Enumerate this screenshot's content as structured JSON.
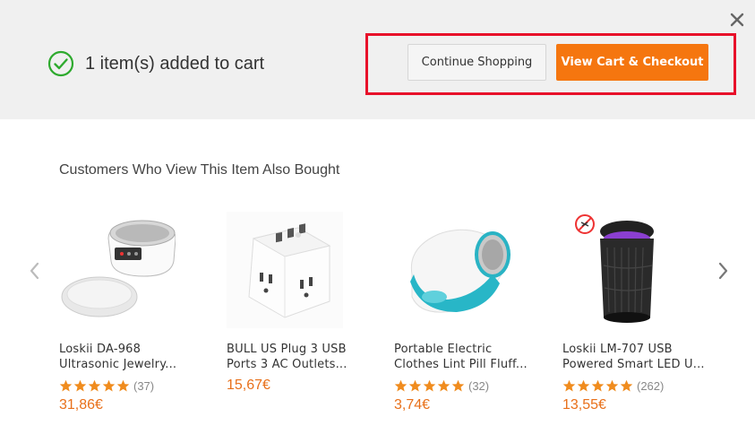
{
  "banner": {
    "message": "1 item(s) added to cart",
    "continue_label": "Continue Shopping",
    "checkout_label": "View Cart & Checkout"
  },
  "recommendations": {
    "title": "Customers Who View This Item Also Bought",
    "products": [
      {
        "name_line1": "Loskii DA-968",
        "name_line2": "Ultrasonic Jewelry...",
        "rating_count": "(37)",
        "price": "31,86€",
        "stars": 5
      },
      {
        "name_line1": "BULL US Plug 3 USB",
        "name_line2": "Ports 3 AC Outlets...",
        "rating_count": "",
        "price": "15,67€",
        "stars": 0
      },
      {
        "name_line1": "Portable Electric",
        "name_line2": "Clothes Lint Pill Fluff...",
        "rating_count": "(32)",
        "price": "3,74€",
        "stars": 5
      },
      {
        "name_line1": "Loskii LM-707 USB",
        "name_line2": "Powered Smart LED U...",
        "rating_count": "(262)",
        "price": "13,55€",
        "stars": 5
      }
    ]
  },
  "colors": {
    "accent": "#f5760f",
    "highlight": "#e8102a",
    "success": "#2eaa2e",
    "star": "#f08c1e"
  },
  "icons": [
    "close-icon",
    "check-circle-icon",
    "chevron-left-icon",
    "chevron-right-icon",
    "star-icon"
  ]
}
